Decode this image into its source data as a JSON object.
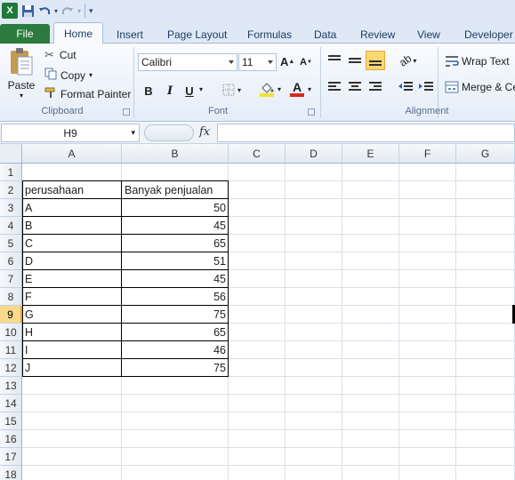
{
  "qat": {
    "app_icon": "excel-logo",
    "save_icon": "save-icon",
    "undo_icon": "undo-icon",
    "redo_icon": "redo-icon"
  },
  "tabs": [
    "File",
    "Home",
    "Insert",
    "Page Layout",
    "Formulas",
    "Data",
    "Review",
    "View",
    "Developer"
  ],
  "ribbon": {
    "clipboard": {
      "paste": "Paste",
      "cut": "Cut",
      "copy": "Copy",
      "format_painter": "Format Painter",
      "label": "Clipboard"
    },
    "font": {
      "name": "Calibri",
      "size": "11",
      "bold": "B",
      "italic": "I",
      "underline": "U",
      "label": "Font",
      "fill_color": "#f3e32b",
      "font_color": "#d9261c"
    },
    "alignment": {
      "wrap_text": "Wrap Text",
      "merge": "Merge & Ce",
      "label": "Alignment"
    }
  },
  "formula_bar": {
    "name_box": "H9",
    "fx": "fx",
    "formula": ""
  },
  "sheet": {
    "columns": [
      "A",
      "B",
      "C",
      "D",
      "E",
      "F",
      "G"
    ],
    "rows": [
      "1",
      "2",
      "3",
      "4",
      "5",
      "6",
      "7",
      "8",
      "9",
      "10",
      "11",
      "12",
      "13",
      "14",
      "15",
      "16",
      "17",
      "18"
    ],
    "selected_row": "9",
    "header": {
      "a": "perusahaan",
      "b": "Banyak penjualan"
    },
    "data": [
      {
        "a": "A",
        "b": "50"
      },
      {
        "a": "B",
        "b": "45"
      },
      {
        "a": "C",
        "b": "65"
      },
      {
        "a": "D",
        "b": "51"
      },
      {
        "a": "E",
        "b": "45"
      },
      {
        "a": "F",
        "b": "56"
      },
      {
        "a": "G",
        "b": "75"
      },
      {
        "a": "H",
        "b": "65"
      },
      {
        "a": "I",
        "b": "46"
      },
      {
        "a": "J",
        "b": "75"
      }
    ]
  }
}
